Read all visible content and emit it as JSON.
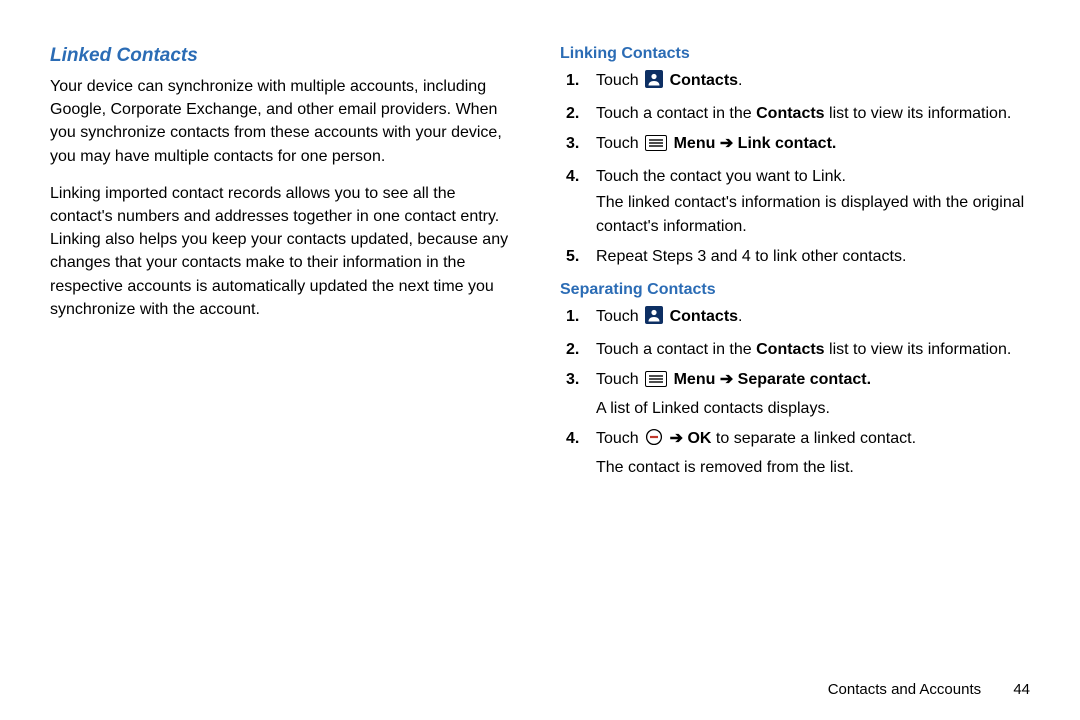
{
  "left": {
    "title": "Linked Contacts",
    "p1": "Your device can synchronize with multiple accounts, including Google, Corporate Exchange, and other email providers. When you synchronize contacts from these accounts with your device, you may have multiple contacts for one person.",
    "p2": "Linking imported contact records allows you to see all the contact's numbers and addresses together in one contact entry. Linking also helps you keep your contacts updated, because any changes that your contacts make to their information in the respective accounts is automatically updated the next time you synchronize with the account."
  },
  "right": {
    "linking": {
      "title": "Linking Contacts",
      "s1a": "Touch ",
      "s1b": " Contacts",
      "s1c": ".",
      "s2a": "Touch a contact in the ",
      "s2b": "Contacts",
      "s2c": " list to view its information.",
      "s3a": "Touch ",
      "s3b": " Menu ",
      "s3c": " Link contact.",
      "s4a": "Touch the contact you want to Link.",
      "s4b": "The linked contact's information is displayed with the original contact's information.",
      "s5": "Repeat Steps 3 and 4 to link other contacts."
    },
    "separating": {
      "title": "Separating Contacts",
      "s1a": "Touch ",
      "s1b": " Contacts",
      "s1c": ".",
      "s2a": "Touch a contact in the ",
      "s2b": "Contacts",
      "s2c": " list to view its information.",
      "s3a": "Touch ",
      "s3b": " Menu ",
      "s3c": " Separate contact.",
      "s3d": "A list of Linked contacts displays.",
      "s4a": "Touch ",
      "s4b": " OK",
      "s4c": " to separate a linked contact.",
      "s4d": "The contact is removed from the list."
    }
  },
  "footer": {
    "label": "Contacts and Accounts",
    "page": "44"
  },
  "glyphs": {
    "arrow": "➔"
  }
}
